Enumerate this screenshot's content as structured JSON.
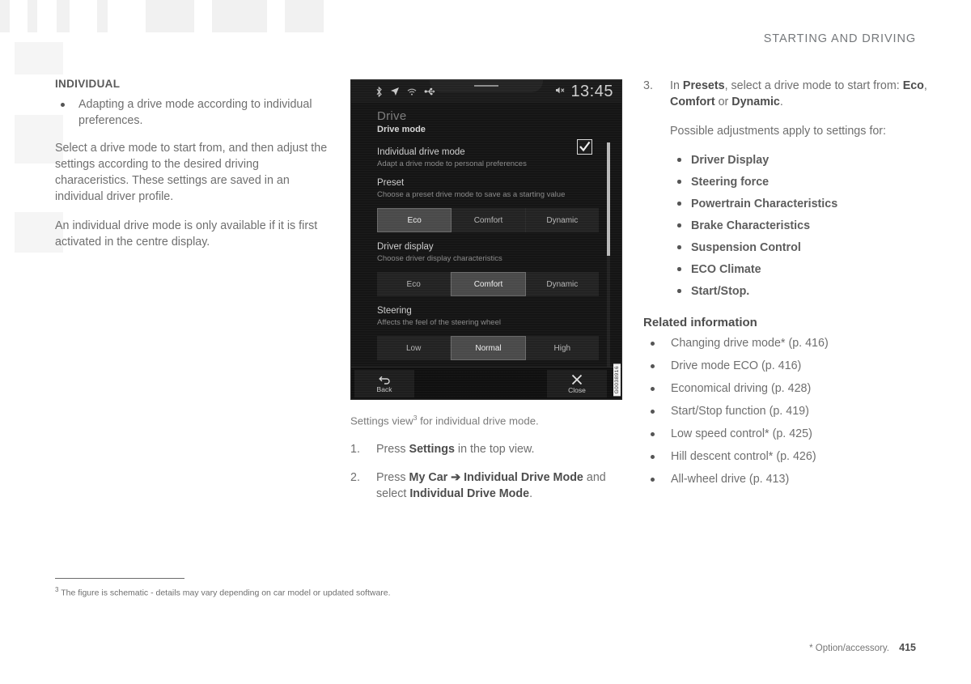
{
  "header": {
    "chapter": "STARTING AND DRIVING"
  },
  "left": {
    "section_title": "INDIVIDUAL",
    "bullets": [
      "Adapting a drive mode according to individual preferences."
    ],
    "paragraphs": [
      "Select a drive mode to start from, and then adjust the settings according to the desired driving characeristics. These settings are saved in an individual driver profile.",
      "An individual drive mode is only available if it is first activated in the centre display."
    ]
  },
  "screen": {
    "statusbar": {
      "icons": [
        "bluetooth-icon",
        "navigation-arrow-icon",
        "wifi-icon",
        "usb-icon"
      ],
      "mute_icon": "volume-mute-icon",
      "clock": "13:45"
    },
    "title": "Drive",
    "subtitle": "Drive mode",
    "rows": [
      {
        "title": "Individual drive mode",
        "desc": "Adapt a drive mode to personal preferences",
        "checkbox": true
      },
      {
        "title": "Preset",
        "desc": "Choose a preset drive mode to save as a starting value",
        "options": [
          "Eco",
          "Comfort",
          "Dynamic"
        ],
        "selected": "Eco"
      },
      {
        "title": "Driver display",
        "desc": "Choose driver display characteristics",
        "options": [
          "Eco",
          "Comfort",
          "Dynamic"
        ],
        "selected": "Comfort"
      },
      {
        "title": "Steering",
        "desc": "Affects the feel of the steering wheel",
        "options": [
          "Low",
          "Normal",
          "High"
        ],
        "selected": "Normal"
      }
    ],
    "bottom_bar": {
      "back_label": "Back",
      "close_label": "Close"
    },
    "image_code": "G0038916"
  },
  "caption": {
    "text_before": "Settings view",
    "footnote_marker": "3",
    "text_after": " for individual drive mode."
  },
  "steps": [
    {
      "num": "1.",
      "html": "Press <b>Settings</b> in the top view."
    },
    {
      "num": "2.",
      "html": "Press <b>My Car ➔ Individual Drive Mode</b> and select <b>Individual Drive Mode</b>."
    }
  ],
  "step3": {
    "num": "3.",
    "html": "In <b>Presets</b>, select a drive mode to start from: <b>Eco</b>, <b>Comfort</b> or <b>Dynamic</b>.",
    "intro": "Possible adjustments apply to settings for:",
    "adjustments": [
      "Driver Display",
      "Steering force",
      "Powertrain Characteristics",
      "Brake Characteristics",
      "Suspension Control",
      "ECO Climate",
      "Start/Stop."
    ]
  },
  "related": {
    "heading": "Related information",
    "links": [
      "Changing drive mode* (p. 416)",
      "Drive mode ECO (p. 416)",
      "Economical driving (p. 428)",
      "Start/Stop function (p. 419)",
      "Low speed control* (p. 425)",
      "Hill descent control* (p. 426)",
      "All-wheel drive (p. 413)"
    ]
  },
  "footnote": {
    "marker": "3",
    "text": "The figure is schematic - details may vary depending on car model or updated software."
  },
  "footer": {
    "note": "* Option/accessory.",
    "page": "415"
  }
}
